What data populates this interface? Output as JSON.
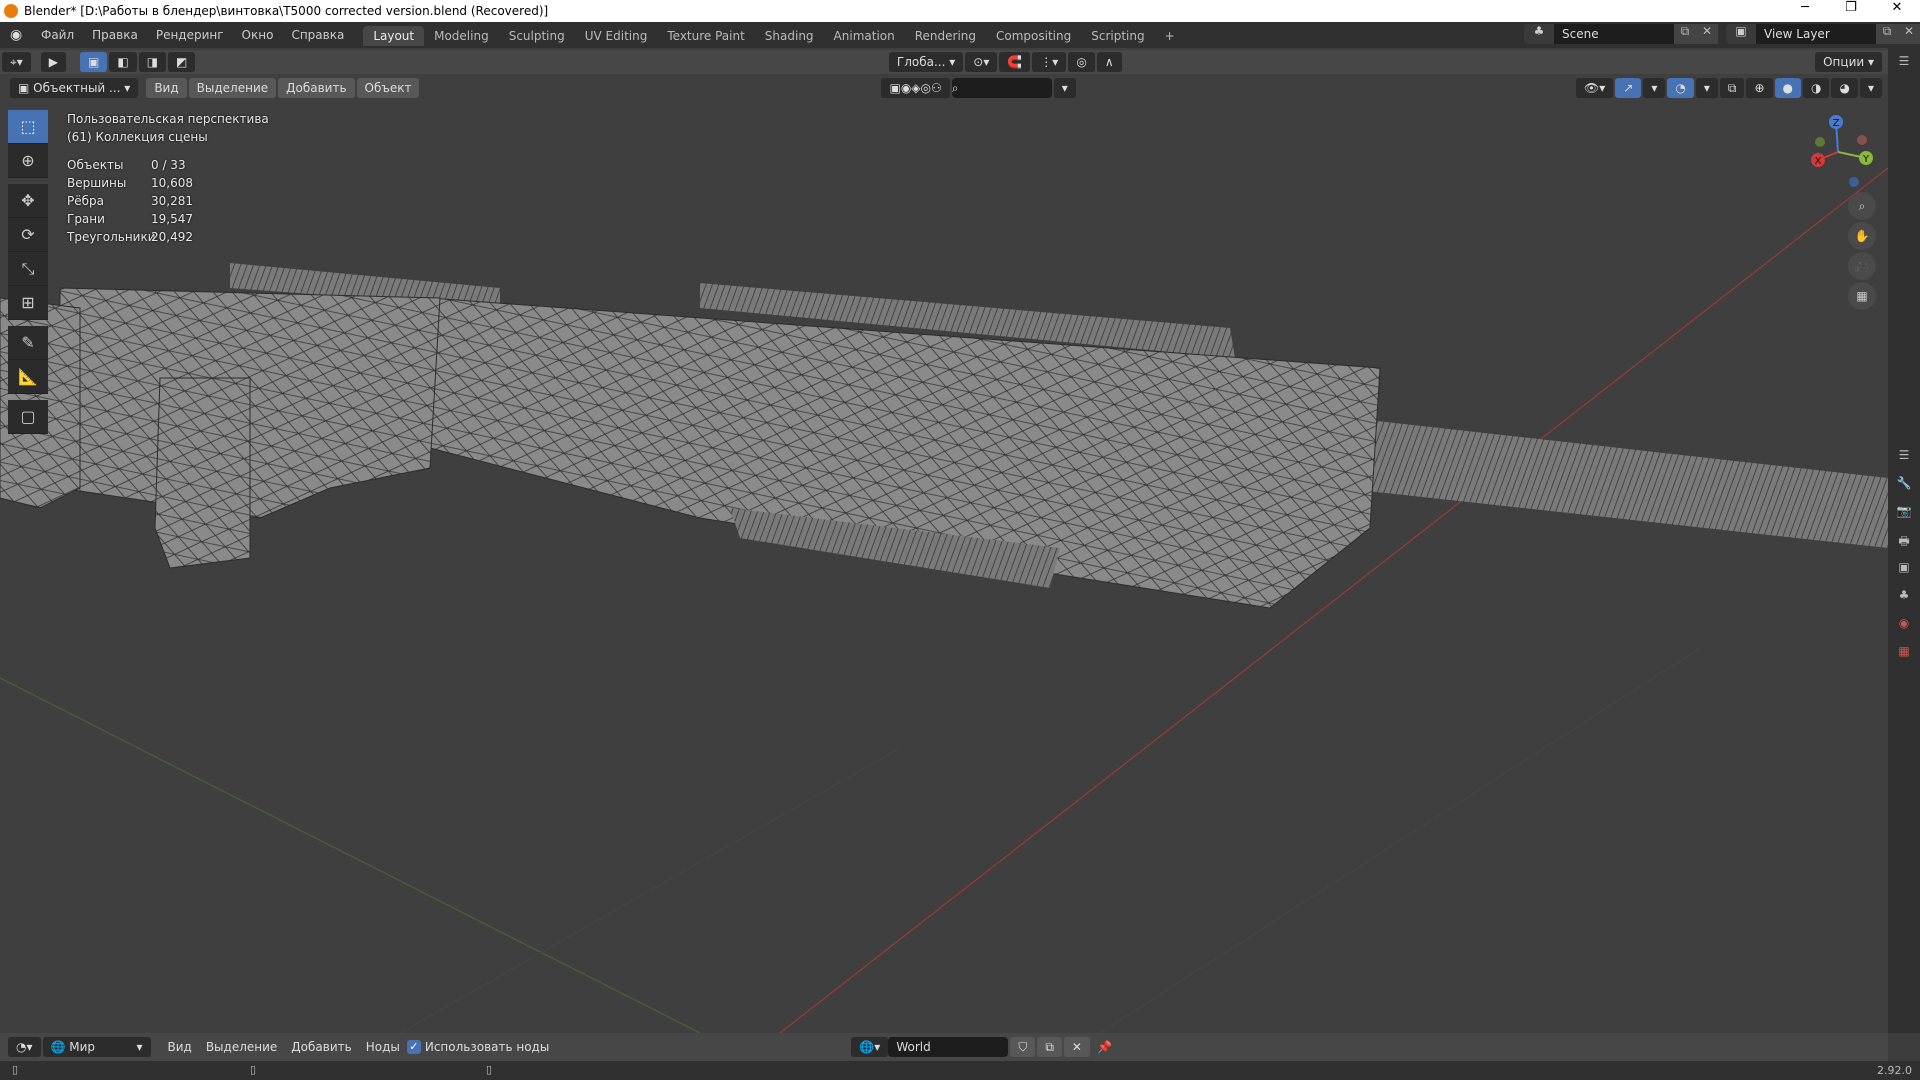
{
  "window": {
    "title": "Blender* [D:\\Работы в блендер\\винтовка\\T5000 corrected version.blend (Recovered)]",
    "minimize": "─",
    "maximize": "❐",
    "close": "✕"
  },
  "menu": [
    "Файл",
    "Правка",
    "Рендеринг",
    "Окно",
    "Справка"
  ],
  "workspaces": [
    "Layout",
    "Modeling",
    "Sculpting",
    "UV Editing",
    "Texture Paint",
    "Shading",
    "Animation",
    "Rendering",
    "Compositing",
    "Scripting",
    "+"
  ],
  "scene": {
    "name": "Scene",
    "view_layer": "View Layer"
  },
  "header": {
    "mode": "Объектный ...",
    "view": "Вид",
    "select": "Выделение",
    "add": "Добавить",
    "object": "Объект",
    "orientation": "Глоба...",
    "options": "Опции"
  },
  "overlay": {
    "view_name": "Пользовательская перспектива",
    "collection": "(61) Коллекция сцены",
    "stats": [
      {
        "label": "Объекты",
        "value": "0 / 33"
      },
      {
        "label": "Вершины",
        "value": "10,608"
      },
      {
        "label": "Рёбра",
        "value": "30,281"
      },
      {
        "label": "Грани",
        "value": "19,547"
      },
      {
        "label": "Треугольники",
        "value": "20,492"
      }
    ]
  },
  "gizmo": {
    "z": "Z",
    "y": "Y",
    "x": "X"
  },
  "bottom": {
    "world_select": "Мир",
    "view": "Вид",
    "select": "Выделение",
    "add": "Добавить",
    "nodes": "Ноды",
    "use_nodes": "Использовать ноды",
    "use_nodes_checked": true,
    "world_name": "World"
  },
  "status": {
    "version": "2.92.0"
  },
  "colors": {
    "accent": "#4772b3",
    "x_axis": "#d03a3a",
    "y_axis": "#8ab838",
    "viewport_bg": "#3f3f3f"
  }
}
